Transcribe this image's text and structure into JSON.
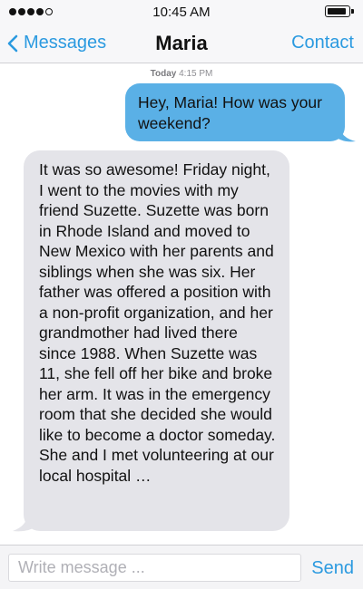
{
  "status_bar": {
    "time": "10:45 AM",
    "signal_bars": 5,
    "signal_filled": 4
  },
  "nav": {
    "back_label": "Messages",
    "title": "Maria",
    "contact_label": "Contact"
  },
  "thread": {
    "timestamp_day": "Today",
    "timestamp_time": "4:15 PM",
    "messages": [
      {
        "direction": "outgoing",
        "text": "Hey, Maria! How was your weekend?"
      },
      {
        "direction": "incoming",
        "text": "It was so awesome! Friday night, I went to the movies with my friend Suzette. Suzette was born in Rhode Island and moved to New Mexico with her parents and siblings when she was six. Her father was offered a position with a non-profit organization, and her grandmother had lived there since 1988. When Suzette was 11, she fell off her bike and broke her arm. It was in the emergency room that she decided she would like to become a doctor someday. She and I met volunteering at our local hospital …"
      }
    ]
  },
  "composer": {
    "placeholder": "Write message ...",
    "value": "",
    "send_label": "Send"
  },
  "colors": {
    "accent": "#2b9ae0",
    "outgoing_bubble": "#5ab0e6",
    "incoming_bubble": "#e4e4e9"
  }
}
